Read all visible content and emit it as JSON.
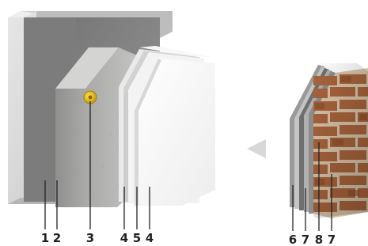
{
  "diagram": {
    "left_assembly_callouts": [
      "1",
      "2",
      "3",
      "4",
      "5",
      "4"
    ],
    "right_assembly_callouts": [
      "6",
      "7",
      "8",
      "7"
    ],
    "colors": {
      "wall": "#d9d9d9",
      "insulation": "#b9bab8",
      "dowel": "#e7c21c",
      "board": "#ffffff",
      "brick": "#a7643c",
      "mortar": "#d8c3a8",
      "arrow": "#dcdcdc",
      "leader": "#222222"
    },
    "icons": [
      "dowel-icon",
      "arrow-left-icon"
    ]
  }
}
